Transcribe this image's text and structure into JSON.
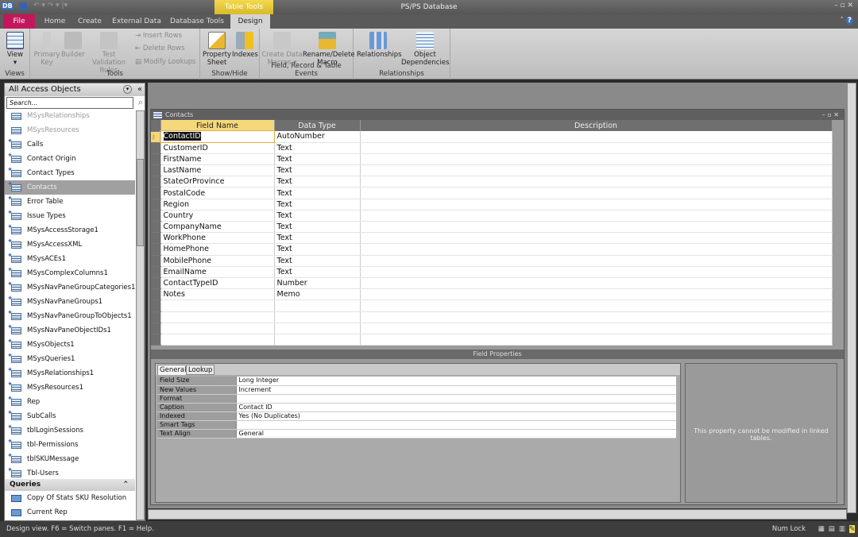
{
  "titlebar": {
    "app_icon": "DB",
    "title": "PS/PS Database",
    "context_tab": "Table Tools"
  },
  "tabs": [
    {
      "label": "File"
    },
    {
      "label": "Home"
    },
    {
      "label": "Create"
    },
    {
      "label": "External Data"
    },
    {
      "label": "Database Tools"
    },
    {
      "label": "Design"
    }
  ],
  "ribbon": {
    "groups": [
      {
        "label": "Views"
      },
      {
        "label": "Tools"
      },
      {
        "label": "Show/Hide"
      },
      {
        "label": "Field, Record & Table Events"
      },
      {
        "label": "Relationships"
      }
    ],
    "view": "View",
    "primary_key": "Primary Key",
    "builder": "Builder",
    "test_validation": "Test Validation Rules",
    "insert_rows": "Insert Rows",
    "delete_rows": "Delete Rows",
    "modify_lookups": "Modify Lookups",
    "property_sheet": "Property Sheet",
    "indexes": "Indexes",
    "create_data_macros": "Create Data Macros",
    "rename_delete_macro": "Rename/Delete Macro",
    "relationships": "Relationships",
    "object_dependencies": "Object Dependencies"
  },
  "nav": {
    "title": "All Access Objects",
    "search_placeholder": "Search...",
    "tables": [
      {
        "label": "MSysRelationships",
        "sys": true
      },
      {
        "label": "MSysResources",
        "sys": true
      },
      {
        "label": "Calls"
      },
      {
        "label": "Contact Origin"
      },
      {
        "label": "Contact Types"
      },
      {
        "label": "Contacts",
        "selected": true
      },
      {
        "label": "Error Table"
      },
      {
        "label": "Issue Types"
      },
      {
        "label": "MSysAccessStorage1"
      },
      {
        "label": "MSysAccessXML"
      },
      {
        "label": "MSysACEs1"
      },
      {
        "label": "MSysComplexColumns1"
      },
      {
        "label": "MSysNavPaneGroupCategories1"
      },
      {
        "label": "MSysNavPaneGroups1"
      },
      {
        "label": "MSysNavPaneGroupToObjects1"
      },
      {
        "label": "MSysNavPaneObjectIDs1"
      },
      {
        "label": "MSysObjects1"
      },
      {
        "label": "MSysQueries1"
      },
      {
        "label": "MSysRelationships1"
      },
      {
        "label": "MSysResources1"
      },
      {
        "label": "Rep"
      },
      {
        "label": "SubCalls"
      },
      {
        "label": "tblLoginSessions"
      },
      {
        "label": "tbl-Permissions"
      },
      {
        "label": "tblSKUMessage"
      },
      {
        "label": "Tbl-Users"
      }
    ],
    "queries_header": "Queries",
    "queries": [
      {
        "label": "Copy Of Stats SKU Resolution"
      },
      {
        "label": "Current Rep"
      }
    ]
  },
  "table_window": {
    "title": "Contacts",
    "columns": [
      "Field Name",
      "Data Type",
      "Description"
    ],
    "rows": [
      [
        "ContactID",
        "AutoNumber"
      ],
      [
        "CustomerID",
        "Text"
      ],
      [
        "FirstName",
        "Text"
      ],
      [
        "LastName",
        "Text"
      ],
      [
        "StateOrProvince",
        "Text"
      ],
      [
        "PostalCode",
        "Text"
      ],
      [
        "Region",
        "Text"
      ],
      [
        "Country",
        "Text"
      ],
      [
        "CompanyName",
        "Text"
      ],
      [
        "WorkPhone",
        "Text"
      ],
      [
        "HomePhone",
        "Text"
      ],
      [
        "MobilePhone",
        "Text"
      ],
      [
        "EmailName",
        "Text"
      ],
      [
        "ContactTypeID",
        "Number"
      ],
      [
        "Notes",
        "Memo"
      ]
    ],
    "field_properties_label": "Field Properties",
    "prop_tabs": [
      "General",
      "Lookup"
    ],
    "properties": [
      [
        "Field Size",
        "Long Integer"
      ],
      [
        "New Values",
        "Increment"
      ],
      [
        "Format",
        ""
      ],
      [
        "Caption",
        "Contact ID"
      ],
      [
        "Indexed",
        "Yes (No Duplicates)"
      ],
      [
        "Smart Tags",
        ""
      ],
      [
        "Text Align",
        "General"
      ]
    ],
    "hint": "This property cannot be modified in linked tables."
  },
  "status": {
    "left": "Design view.  F6 = Switch panes.  F1 = Help.",
    "num_lock": "Num Lock"
  }
}
